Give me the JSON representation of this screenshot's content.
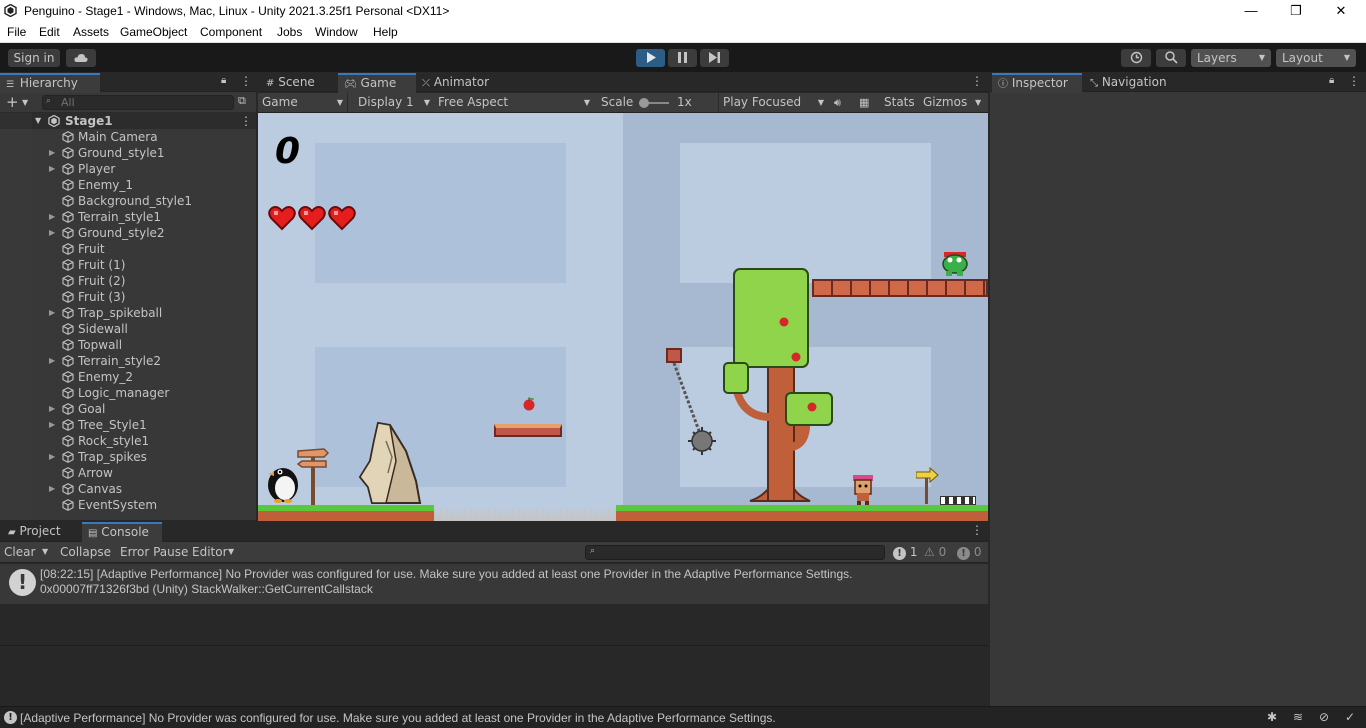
{
  "window": {
    "title": "Penguino - Stage1 - Windows, Mac, Linux - Unity 2021.3.25f1 Personal <DX11>",
    "minimize": "—",
    "restore": "❐",
    "close": "✕"
  },
  "menu": [
    "File",
    "Edit",
    "Assets",
    "GameObject",
    "Component",
    "Jobs",
    "Window",
    "Help"
  ],
  "toolbar": {
    "sign_in": "Sign in",
    "layers": "Layers",
    "layout": "Layout"
  },
  "hierarchy": {
    "tab": "Hierarchy",
    "search_placeholder": "All",
    "scene": "Stage1",
    "items": [
      {
        "label": "Main Camera",
        "expandable": false
      },
      {
        "label": "Ground_style1",
        "expandable": true
      },
      {
        "label": "Player",
        "expandable": true
      },
      {
        "label": "Enemy_1",
        "expandable": false
      },
      {
        "label": "Background_style1",
        "expandable": false
      },
      {
        "label": "Terrain_style1",
        "expandable": true
      },
      {
        "label": "Ground_style2",
        "expandable": true
      },
      {
        "label": "Fruit",
        "expandable": false
      },
      {
        "label": "Fruit (1)",
        "expandable": false
      },
      {
        "label": "Fruit (2)",
        "expandable": false
      },
      {
        "label": "Fruit (3)",
        "expandable": false
      },
      {
        "label": "Trap_spikeball",
        "expandable": true
      },
      {
        "label": "Sidewall",
        "expandable": false
      },
      {
        "label": "Topwall",
        "expandable": false
      },
      {
        "label": "Terrain_style2",
        "expandable": true
      },
      {
        "label": "Enemy_2",
        "expandable": false
      },
      {
        "label": "Logic_manager",
        "expandable": false
      },
      {
        "label": "Goal",
        "expandable": true
      },
      {
        "label": "Tree_Style1",
        "expandable": true
      },
      {
        "label": "Rock_style1",
        "expandable": false
      },
      {
        "label": "Trap_spikes",
        "expandable": true
      },
      {
        "label": "Arrow",
        "expandable": false
      },
      {
        "label": "Canvas",
        "expandable": true
      },
      {
        "label": "EventSystem",
        "expandable": false
      }
    ]
  },
  "center": {
    "tabs": {
      "scene": "Scene",
      "game": "Game",
      "animator": "Animator"
    },
    "game_bar": {
      "view": "Game",
      "display": "Display 1",
      "aspect": "Free Aspect",
      "scale_label": "Scale",
      "scale_value": "1x",
      "play_mode": "Play Focused",
      "stats": "Stats",
      "gizmos": "Gizmos"
    },
    "game": {
      "score": "0",
      "hearts": 3
    }
  },
  "inspector": {
    "tab": "Inspector",
    "nav_tab": "Navigation"
  },
  "bottom": {
    "tabs": {
      "project": "Project",
      "console": "Console"
    },
    "console_bar": {
      "clear": "Clear",
      "collapse": "Collapse",
      "error_pause": "Error Pause",
      "editor": "Editor",
      "count_log": "1",
      "count_warn": "0",
      "count_error": "0"
    },
    "messages": [
      {
        "line1": "[08:22:15] [Adaptive Performance] No Provider was configured for use. Make sure you added at least one Provider in the Adaptive Performance Settings.",
        "line2": "0x00007ff71326f3bd (Unity) StackWalker::GetCurrentCallstack"
      }
    ]
  },
  "status": {
    "message": "[Adaptive Performance] No Provider was configured for use. Make sure you added at least one Provider in the Adaptive Performance Settings."
  },
  "colors": {
    "accent": "#3a79bb",
    "play_active": "#2c5d87"
  }
}
